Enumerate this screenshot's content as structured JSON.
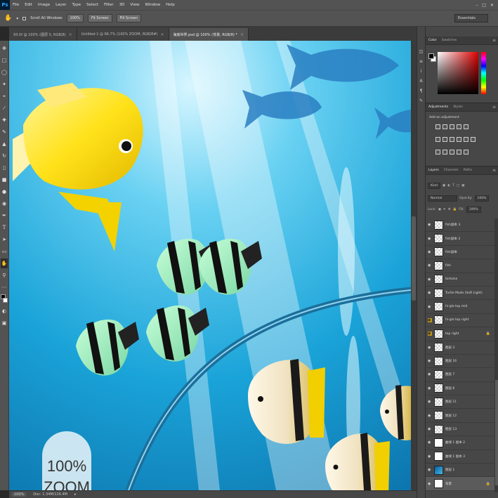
{
  "menubar": {
    "logo": "Ps",
    "items": [
      "File",
      "Edit",
      "Image",
      "Layer",
      "Type",
      "Select",
      "Filter",
      "3D",
      "View",
      "Window",
      "Help"
    ],
    "window_controls": [
      "–",
      "□",
      "✕"
    ]
  },
  "options_bar": {
    "scroll_all_windows": "Scroll All Windows",
    "zoom_100": "100%",
    "fit_screen": "Fit Screen",
    "fill_screen": "Fill Screen",
    "workspace": "Essentials"
  },
  "tabs": [
    {
      "label": "93.tif @ 100% (图层 5, RGB/8)",
      "active": false
    },
    {
      "label": "Untitled-1 @ 66.7% (100% ZOOM, RGB/8#)",
      "active": false
    },
    {
      "label": "海底世界.psd @ 100% (背景, RGB/8) *",
      "active": true
    }
  ],
  "canvas": {
    "zoom_watermark_line1": "100%",
    "zoom_watermark_line2": "ZOOM"
  },
  "status_bar": {
    "zoom": "100%",
    "doc": "Doc: 1.34M/126.4M"
  },
  "color_panel": {
    "tabs": [
      "Color",
      "Swatches"
    ],
    "foreground": "#000000",
    "background": "#ffffff"
  },
  "adjustments_panel": {
    "tabs": [
      "Adjustments",
      "Styles"
    ],
    "title": "Add an adjustment"
  },
  "layers_panel": {
    "tabs": [
      "Layers",
      "Channels",
      "Paths"
    ],
    "filter_kind": "Kind",
    "blend_mode": "Normal",
    "opacity_label": "Opacity:",
    "opacity_value": "100%",
    "lock_label": "Lock:",
    "fill_label": "Fill:",
    "fill_value": "100%",
    "layers": [
      {
        "name": "fish副本 3",
        "thumb": "checker",
        "highlight": false,
        "locked": false
      },
      {
        "name": "fish副本 2",
        "thumb": "checker",
        "highlight": false,
        "locked": false
      },
      {
        "name": "fish副本",
        "thumb": "checker",
        "highlight": false,
        "locked": false
      },
      {
        "name": "fish",
        "thumb": "checker",
        "highlight": false,
        "locked": false
      },
      {
        "name": "tortoise",
        "thumb": "checker",
        "highlight": false,
        "locked": false
      },
      {
        "name": "Turtle Mode (Soft Light)",
        "thumb": "checker",
        "highlight": false,
        "locked": false
      },
      {
        "name": "hi-glo top mid",
        "thumb": "checker",
        "highlight": false,
        "locked": false
      },
      {
        "name": "hi-glo top right",
        "thumb": "checker",
        "highlight": true,
        "locked": false
      },
      {
        "name": "top right",
        "thumb": "checker",
        "highlight": true,
        "locked": true
      },
      {
        "name": "图层 3",
        "thumb": "checker",
        "highlight": false,
        "locked": false
      },
      {
        "name": "图层 16",
        "thumb": "checker",
        "highlight": false,
        "locked": false
      },
      {
        "name": "图层 7",
        "thumb": "checker",
        "highlight": false,
        "locked": false
      },
      {
        "name": "图层 6",
        "thumb": "checker",
        "highlight": false,
        "locked": false
      },
      {
        "name": "图层 11",
        "thumb": "checker",
        "highlight": false,
        "locked": false
      },
      {
        "name": "图层 12",
        "thumb": "checker",
        "highlight": false,
        "locked": false
      },
      {
        "name": "图层 13",
        "thumb": "checker",
        "highlight": false,
        "locked": false
      },
      {
        "name": "曲线 1 副本 2",
        "thumb": "white",
        "highlight": false,
        "locked": false
      },
      {
        "name": "曲线 1 副本 3",
        "thumb": "white",
        "highlight": false,
        "locked": false
      },
      {
        "name": "图层 1",
        "thumb": "img",
        "highlight": false,
        "locked": false
      },
      {
        "name": "背景",
        "thumb": "white",
        "highlight": false,
        "locked": true,
        "selected": true
      }
    ]
  }
}
